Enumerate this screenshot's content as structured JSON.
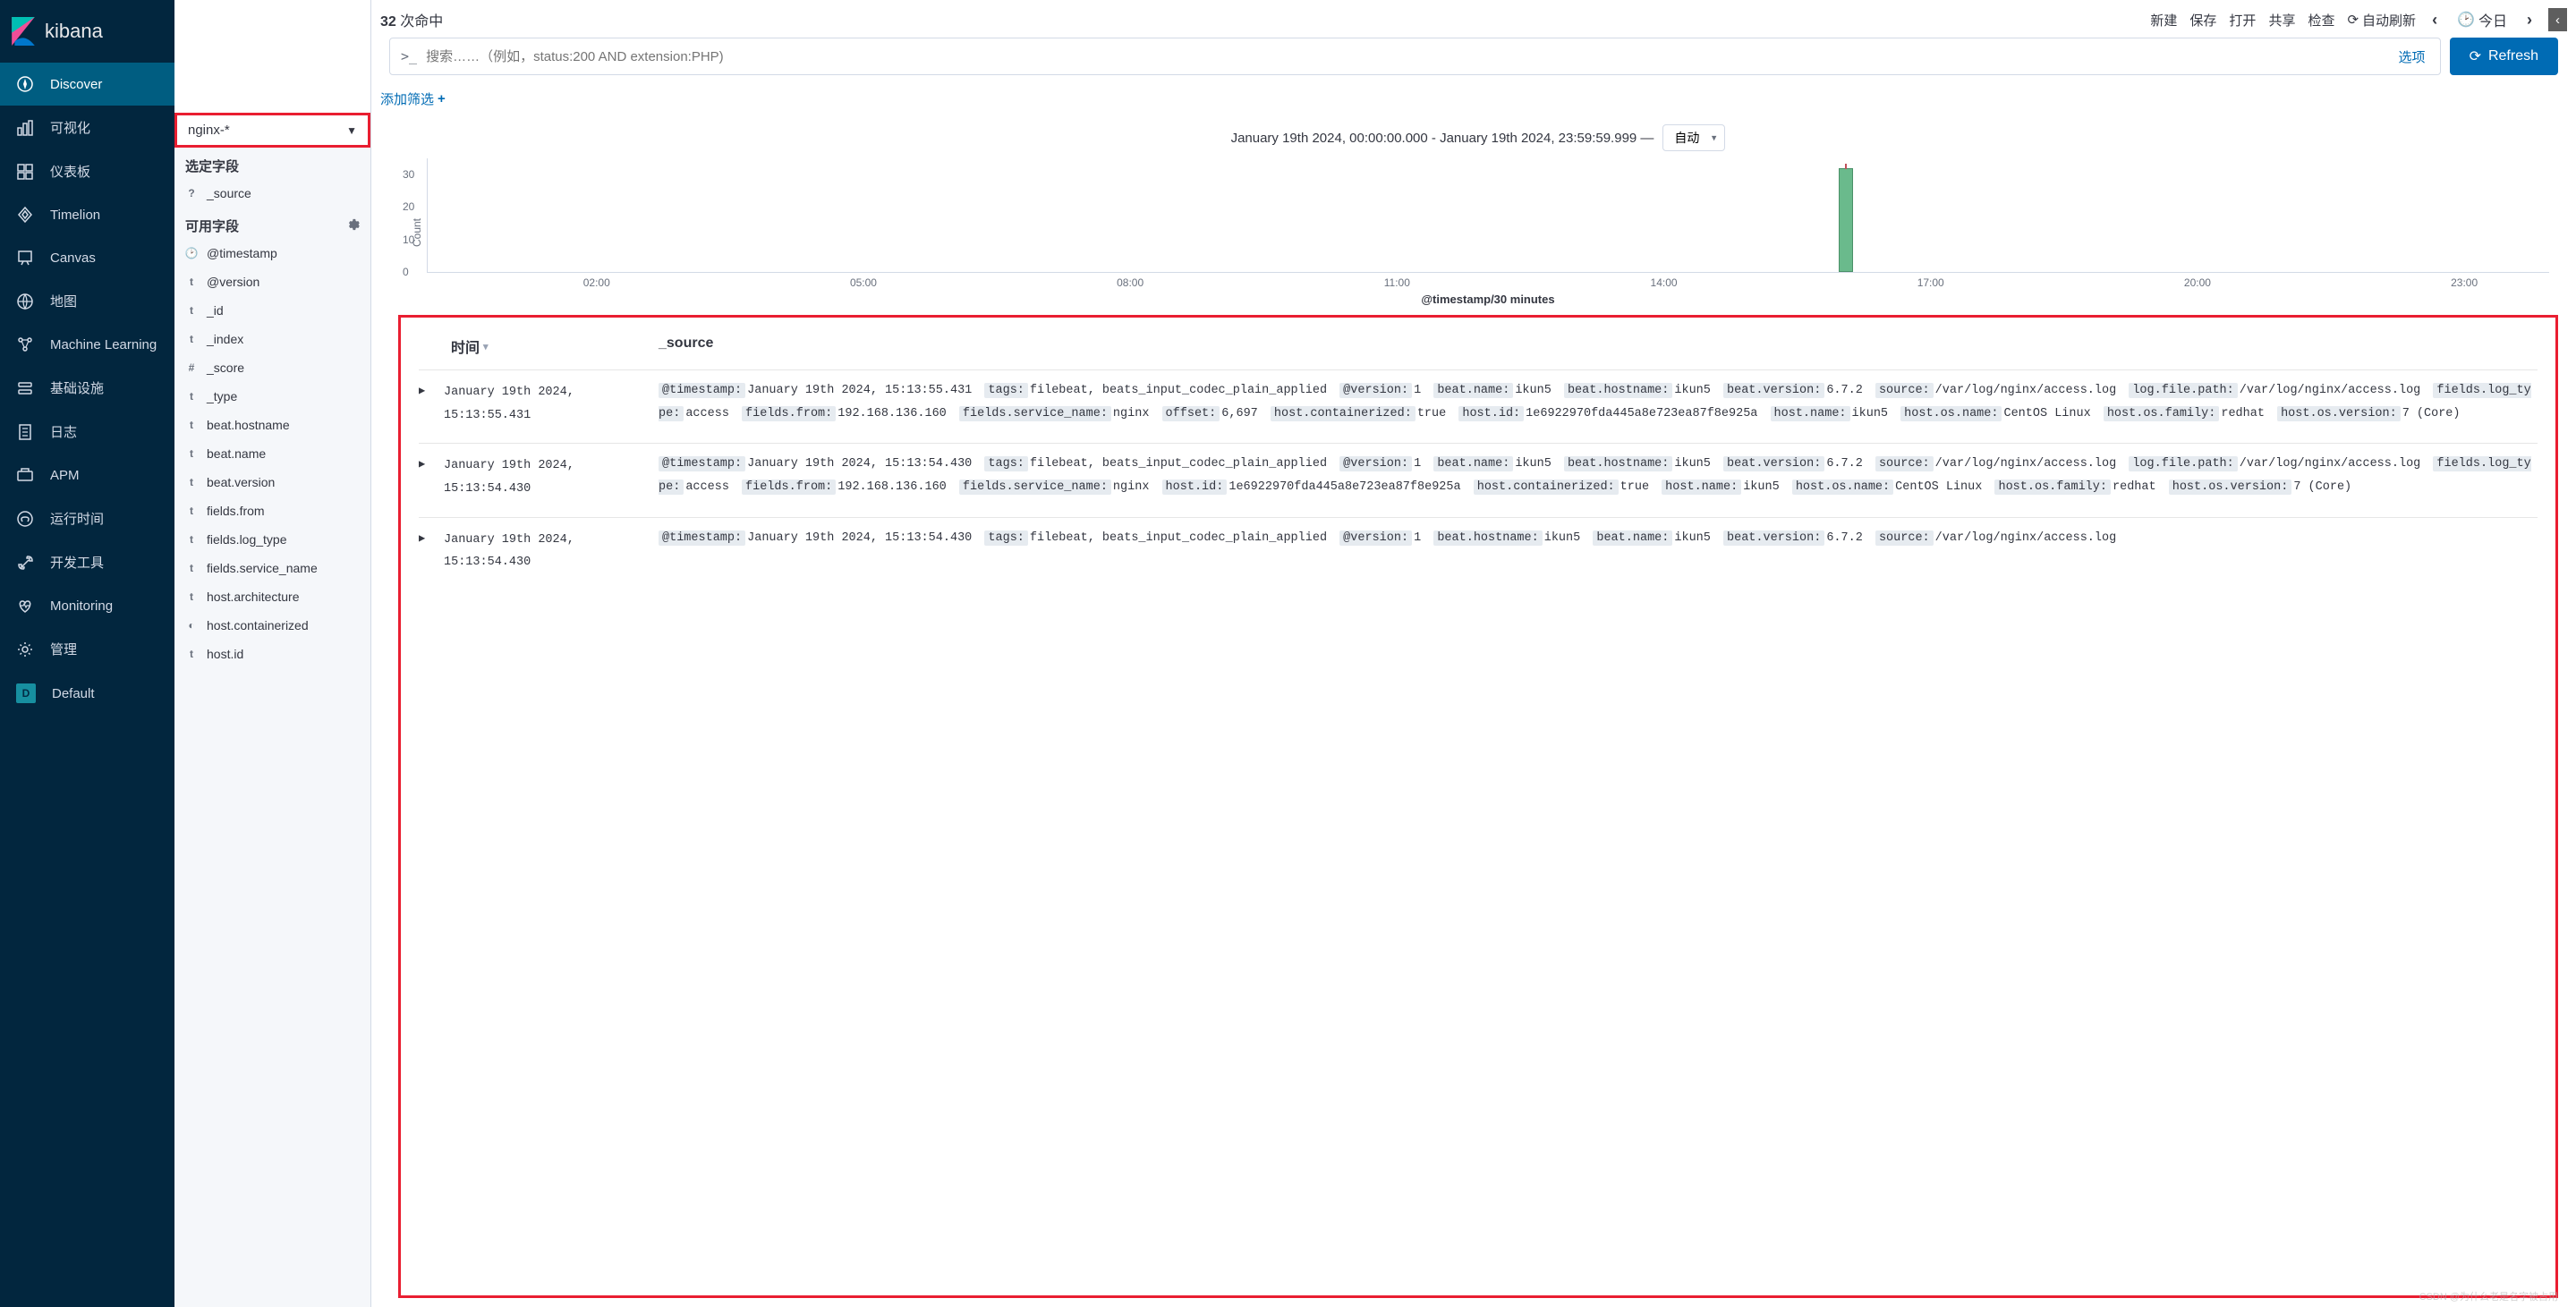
{
  "brand": "kibana",
  "nav": {
    "items": [
      {
        "icon": "compass",
        "label": "Discover",
        "active": true
      },
      {
        "icon": "barchart",
        "label": "可视化"
      },
      {
        "icon": "dashboard",
        "label": "仪表板"
      },
      {
        "icon": "timelion",
        "label": "Timelion"
      },
      {
        "icon": "canvas",
        "label": "Canvas"
      },
      {
        "icon": "map",
        "label": "地图"
      },
      {
        "icon": "ml",
        "label": "Machine Learning"
      },
      {
        "icon": "infra",
        "label": "基础设施"
      },
      {
        "icon": "logs",
        "label": "日志"
      },
      {
        "icon": "apm",
        "label": "APM"
      },
      {
        "icon": "uptime",
        "label": "运行时间"
      },
      {
        "icon": "devtools",
        "label": "开发工具"
      },
      {
        "icon": "heartbeat",
        "label": "Monitoring"
      },
      {
        "icon": "gear",
        "label": "管理"
      }
    ],
    "default_label": "Default",
    "default_badge": "D"
  },
  "hits": {
    "count": "32",
    "label": "次命中"
  },
  "topbar": {
    "new": "新建",
    "save": "保存",
    "open": "打开",
    "share": "共享",
    "inspect": "检查",
    "auto_refresh": "自动刷新",
    "today": "今日"
  },
  "search": {
    "prefix": ">_",
    "placeholder": "搜索……（例如，status:200 AND extension:PHP)",
    "options": "选项",
    "refresh": "Refresh"
  },
  "filter": {
    "add": "添加筛选"
  },
  "index_pattern": "nginx-*",
  "fields": {
    "selected_label": "选定字段",
    "available_label": "可用字段",
    "selected": [
      {
        "type": "?",
        "name": "_source"
      }
    ],
    "available": [
      {
        "type": "clock",
        "name": "@timestamp"
      },
      {
        "type": "t",
        "name": "@version"
      },
      {
        "type": "t",
        "name": "_id"
      },
      {
        "type": "t",
        "name": "_index"
      },
      {
        "type": "#",
        "name": "_score"
      },
      {
        "type": "t",
        "name": "_type"
      },
      {
        "type": "t",
        "name": "beat.hostname"
      },
      {
        "type": "t",
        "name": "beat.name"
      },
      {
        "type": "t",
        "name": "beat.version"
      },
      {
        "type": "t",
        "name": "fields.from"
      },
      {
        "type": "t",
        "name": "fields.log_type"
      },
      {
        "type": "t",
        "name": "fields.service_name"
      },
      {
        "type": "t",
        "name": "host.architecture"
      },
      {
        "type": "bool",
        "name": "host.containerized"
      },
      {
        "type": "t",
        "name": "host.id"
      }
    ]
  },
  "histogram": {
    "time_range": "January 19th 2024, 00:00:00.000 - January 19th 2024, 23:59:59.999 —",
    "interval": "自动",
    "y_label": "Count",
    "axis_title": "@timestamp/30 minutes"
  },
  "chart_data": {
    "type": "bar",
    "categories": [
      "02:00",
      "05:00",
      "08:00",
      "11:00",
      "14:00",
      "17:00",
      "20:00",
      "23:00"
    ],
    "y_ticks": [
      0,
      10,
      20,
      30
    ],
    "ylim": [
      0,
      35
    ],
    "bars": [
      {
        "x_pct": 66.5,
        "value": 32
      }
    ],
    "xlabel": "@timestamp/30 minutes",
    "ylabel": "Count"
  },
  "docs": {
    "col_time": "时间",
    "col_source": "_source",
    "rows": [
      {
        "time": "January 19th 2024, 15:13:55.431",
        "pairs": [
          {
            "k": "@timestamp:",
            "v": "January 19th 2024, 15:13:55.431"
          },
          {
            "k": "tags:",
            "v": "filebeat, beats_input_codec_plain_applied"
          },
          {
            "k": "@version:",
            "v": "1"
          },
          {
            "k": "beat.name:",
            "v": "ikun5"
          },
          {
            "k": "beat.hostname:",
            "v": "ikun5"
          },
          {
            "k": "beat.version:",
            "v": "6.7.2"
          },
          {
            "k": "source:",
            "v": "/var/log/nginx/access.log"
          },
          {
            "k": "log.file.path:",
            "v": "/var/log/nginx/access.log"
          },
          {
            "k": "fields.log_type:",
            "v": "access"
          },
          {
            "k": "fields.from:",
            "v": "192.168.136.160"
          },
          {
            "k": "fields.service_name:",
            "v": "nginx"
          },
          {
            "k": "offset:",
            "v": "6,697"
          },
          {
            "k": "host.containerized:",
            "v": "true"
          },
          {
            "k": "host.id:",
            "v": "1e6922970fda445a8e723ea87f8e925a"
          },
          {
            "k": "host.name:",
            "v": "ikun5"
          },
          {
            "k": "host.os.name:",
            "v": "CentOS Linux"
          },
          {
            "k": "host.os.family:",
            "v": "redhat"
          },
          {
            "k": "host.os.version:",
            "v": "7 (Core)"
          }
        ]
      },
      {
        "time": "January 19th 2024, 15:13:54.430",
        "pairs": [
          {
            "k": "@timestamp:",
            "v": "January 19th 2024, 15:13:54.430"
          },
          {
            "k": "tags:",
            "v": "filebeat, beats_input_codec_plain_applied"
          },
          {
            "k": "@version:",
            "v": "1"
          },
          {
            "k": "beat.name:",
            "v": "ikun5"
          },
          {
            "k": "beat.hostname:",
            "v": "ikun5"
          },
          {
            "k": "beat.version:",
            "v": "6.7.2"
          },
          {
            "k": "source:",
            "v": "/var/log/nginx/access.log"
          },
          {
            "k": "log.file.path:",
            "v": "/var/log/nginx/access.log"
          },
          {
            "k": "fields.log_type:",
            "v": "access"
          },
          {
            "k": "fields.from:",
            "v": "192.168.136.160"
          },
          {
            "k": "fields.service_name:",
            "v": "nginx"
          },
          {
            "k": "host.id:",
            "v": "1e6922970fda445a8e723ea87f8e925a"
          },
          {
            "k": "host.containerized:",
            "v": "true"
          },
          {
            "k": "host.name:",
            "v": "ikun5"
          },
          {
            "k": "host.os.name:",
            "v": "CentOS Linux"
          },
          {
            "k": "host.os.family:",
            "v": "redhat"
          },
          {
            "k": "host.os.version:",
            "v": "7 (Core)"
          }
        ]
      },
      {
        "time": "January 19th 2024, 15:13:54.430",
        "pairs": [
          {
            "k": "@timestamp:",
            "v": "January 19th 2024, 15:13:54.430"
          },
          {
            "k": "tags:",
            "v": "filebeat, beats_input_codec_plain_applied"
          },
          {
            "k": "@version:",
            "v": "1"
          },
          {
            "k": "beat.hostname:",
            "v": "ikun5"
          },
          {
            "k": "beat.name:",
            "v": "ikun5"
          },
          {
            "k": "beat.version:",
            "v": "6.7.2"
          },
          {
            "k": "source:",
            "v": "/var/log/nginx/access.log"
          }
        ]
      }
    ]
  },
  "watermark": "CSDN @为什么老是名字被占用"
}
